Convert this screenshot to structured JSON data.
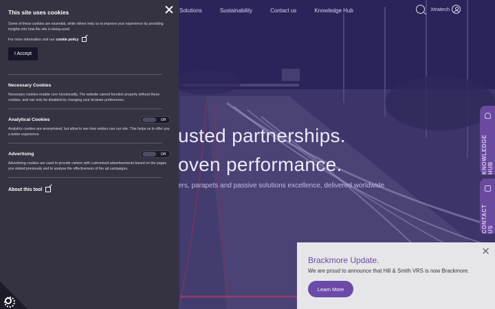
{
  "nav": {
    "links": [
      "Solutions",
      "Sustainability",
      "Contact us",
      "Knowledge Hub"
    ],
    "user_label": "Xtratech"
  },
  "hero": {
    "headline_line1": "usted partnerships.",
    "headline_line2": "oven performance.",
    "subline": "ers, parapets and passive solutions excellence, delivered worldwide"
  },
  "side_tabs": {
    "knowledge": "KNOWLEDGE HUB",
    "contact": "CONTACT US"
  },
  "cookie_panel": {
    "title": "This site uses cookies",
    "intro": "Some of these cookies are essential, while others help us to improve your experience by providing insights into how the site is being used.",
    "info_prefix": "For more information visit our",
    "info_link": "cookie policy",
    "accept_label": "I Accept",
    "necessary": {
      "title": "Necessary Cookies",
      "text": "Necessary cookies enable core functionality. The website cannot function properly without these cookies, and can only be disabled by changing your browser preferences."
    },
    "analytical": {
      "title": "Analytical Cookies",
      "text": "Analytics cookies are anonymised, but allow to see how visitors use our site. This helps us to offer you a better experience.",
      "toggle_state": "Off"
    },
    "advertising": {
      "title": "Advertising",
      "text": "Advertising cookies are used to provide visitors with customised advertisements based on the pages you visited previously and to analyse the effectiveness of the ad campaigns.",
      "toggle_state": "Off"
    },
    "about_label": "About this tool"
  },
  "popup": {
    "title": "Brackmore Update.",
    "text": "We are proud to announce that Hill & Smith VRS is now Brackmore.",
    "button_label": "Learn More"
  },
  "colors": {
    "panel_bg": "#353342",
    "accent_purple": "#6b4aa8",
    "popup_bg": "#e6e6e8"
  }
}
